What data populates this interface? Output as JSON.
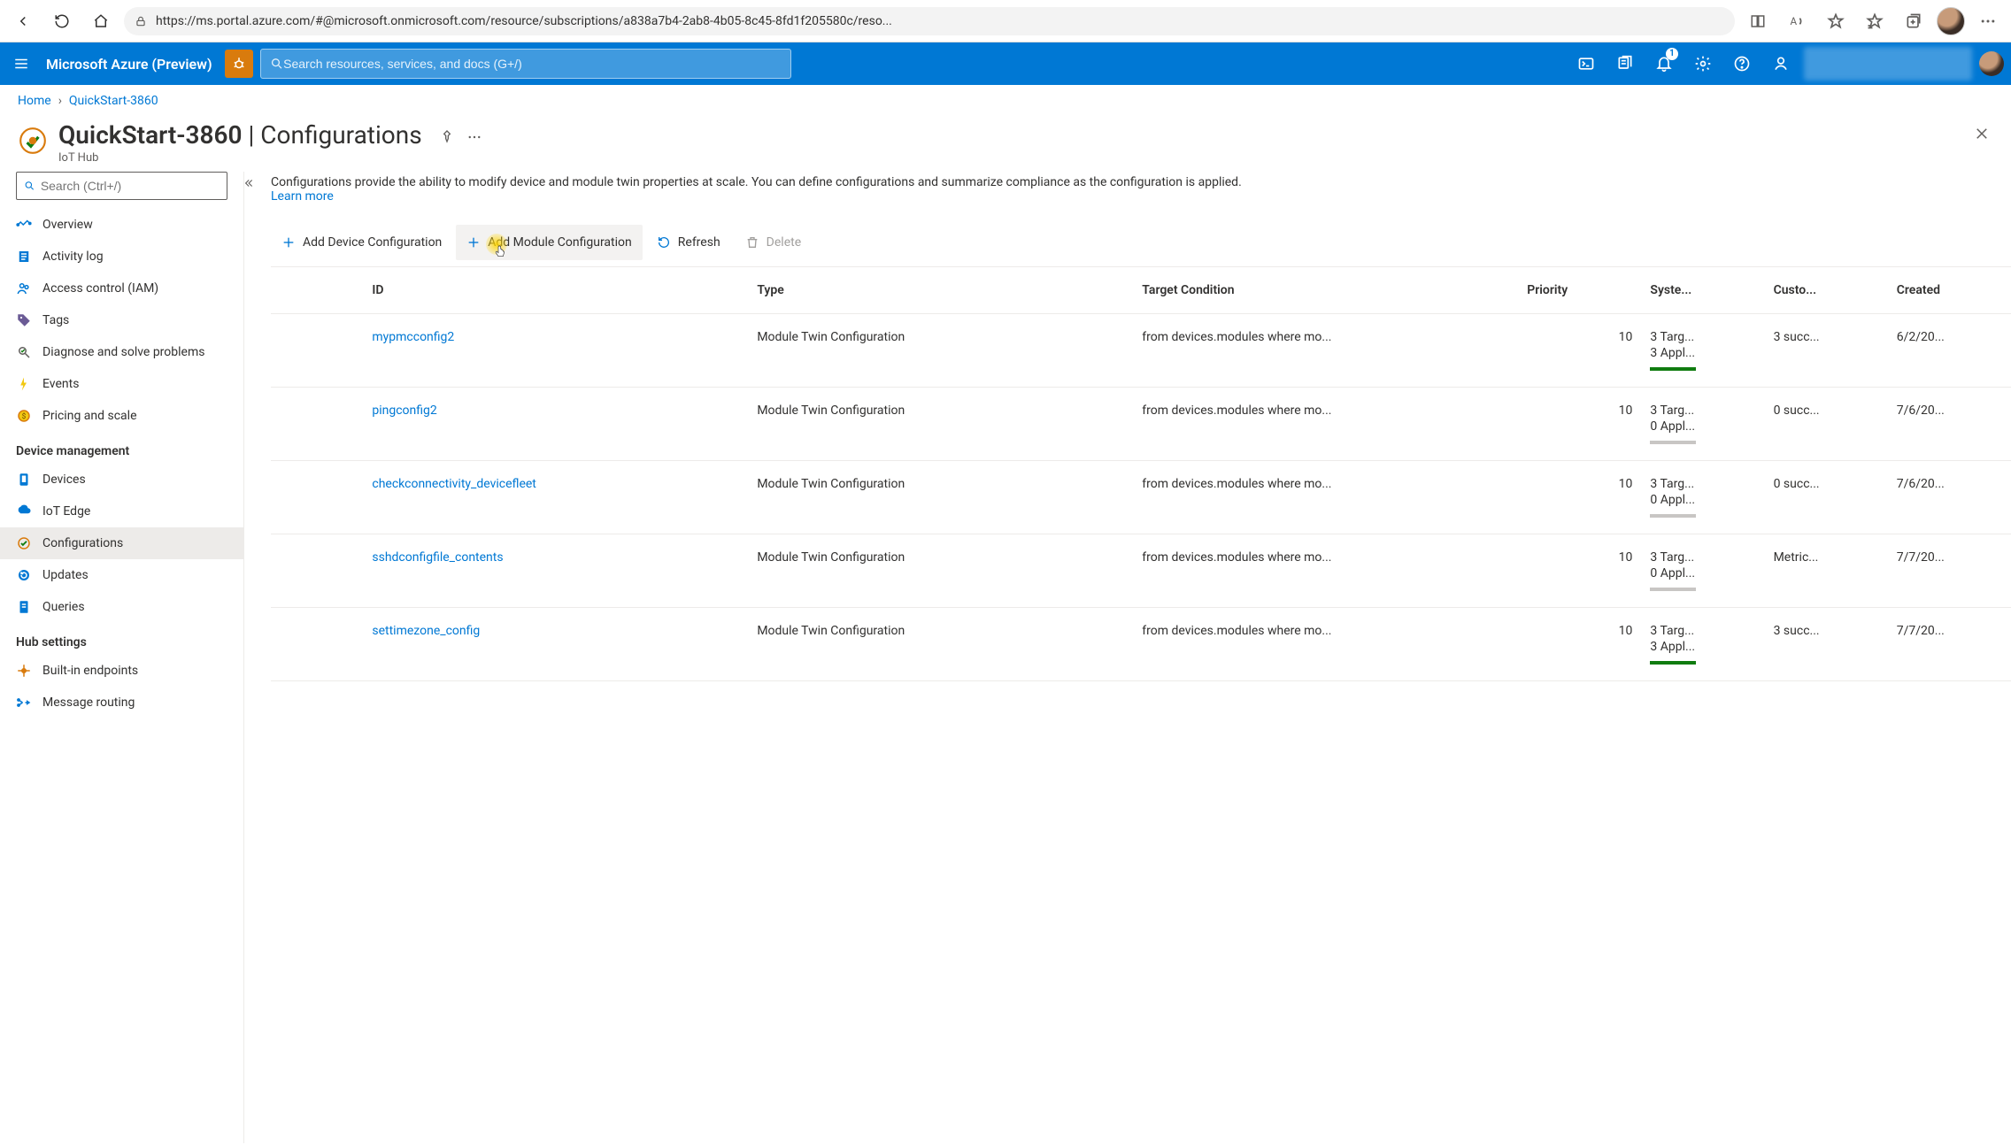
{
  "browser": {
    "url": "https://ms.portal.azure.com/#@microsoft.onmicrosoft.com/resource/subscriptions/a838a7b4-2ab8-4b05-8c45-8fd1f205580c/reso..."
  },
  "azure": {
    "brand": "Microsoft Azure (Preview)",
    "search_placeholder": "Search resources, services, and docs (G+/)",
    "notifications_badge": "1"
  },
  "breadcrumb": {
    "home": "Home",
    "current": "QuickStart-3860"
  },
  "header": {
    "resource_name": "QuickStart-3860",
    "section": "Configurations",
    "subtitle": "IoT Hub"
  },
  "sidebar": {
    "search_placeholder": "Search (Ctrl+/)",
    "items_top": [
      {
        "label": "Overview"
      },
      {
        "label": "Activity log"
      },
      {
        "label": "Access control (IAM)"
      },
      {
        "label": "Tags"
      },
      {
        "label": "Diagnose and solve problems"
      },
      {
        "label": "Events"
      },
      {
        "label": "Pricing and scale"
      }
    ],
    "section_device": "Device management",
    "items_device": [
      {
        "label": "Devices"
      },
      {
        "label": "IoT Edge"
      },
      {
        "label": "Configurations"
      },
      {
        "label": "Updates"
      },
      {
        "label": "Queries"
      }
    ],
    "section_hub": "Hub settings",
    "items_hub": [
      {
        "label": "Built-in endpoints"
      },
      {
        "label": "Message routing"
      }
    ]
  },
  "main": {
    "intro": "Configurations provide the ability to modify device and module twin properties at scale. You can define configurations and summarize compliance as the configuration is applied.",
    "learn_more": "Learn more",
    "toolbar": {
      "add_device": "Add Device Configuration",
      "add_module": "Add Module Configuration",
      "refresh": "Refresh",
      "delete": "Delete"
    },
    "columns": {
      "id": "ID",
      "type": "Type",
      "target": "Target Condition",
      "priority": "Priority",
      "system": "Syste...",
      "custom": "Custo...",
      "created": "Created"
    },
    "rows": [
      {
        "id": "mypmcconfig2",
        "type": "Module Twin Configuration",
        "target": "from devices.modules where mo...",
        "priority": "10",
        "sys_line1": "3 Targ...",
        "sys_line2": "3 Appl...",
        "bar_green": true,
        "custom": "3 succ...",
        "created": "6/2/20..."
      },
      {
        "id": "pingconfig2",
        "type": "Module Twin Configuration",
        "target": "from devices.modules where mo...",
        "priority": "10",
        "sys_line1": "3 Targ...",
        "sys_line2": "0 Appl...",
        "bar_green": false,
        "custom": "0 succ...",
        "created": "7/6/20..."
      },
      {
        "id": "checkconnectivity_devicefleet",
        "type": "Module Twin Configuration",
        "target": "from devices.modules where mo...",
        "priority": "10",
        "sys_line1": "3 Targ...",
        "sys_line2": "0 Appl...",
        "bar_green": false,
        "custom": "0 succ...",
        "created": "7/6/20..."
      },
      {
        "id": "sshdconfigfile_contents",
        "type": "Module Twin Configuration",
        "target": "from devices.modules where mo...",
        "priority": "10",
        "sys_line1": "3 Targ...",
        "sys_line2": "0 Appl...",
        "bar_green": false,
        "custom": "Metric...",
        "created": "7/7/20..."
      },
      {
        "id": "settimezone_config",
        "type": "Module Twin Configuration",
        "target": "from devices.modules where mo...",
        "priority": "10",
        "sys_line1": "3 Targ...",
        "sys_line2": "3 Appl...",
        "bar_green": true,
        "custom": "3 succ...",
        "created": "7/7/20..."
      }
    ]
  }
}
